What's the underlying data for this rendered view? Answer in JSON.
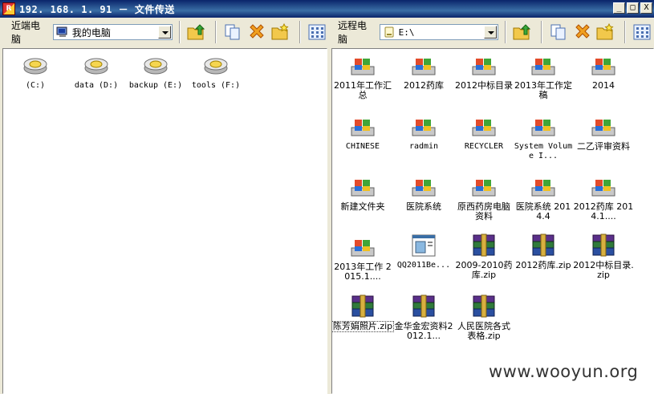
{
  "window": {
    "title": "192. 168. 1. 91 － 文件传送",
    "min_glyph": "_",
    "max_glyph": "□",
    "close_glyph": "X"
  },
  "left": {
    "label": "近端电脑",
    "location": "我的电脑",
    "location_icon": "my-computer-icon",
    "items": [
      {
        "label": "(C:)",
        "icon": "drive-icon"
      },
      {
        "label": "data (D:)",
        "icon": "drive-icon"
      },
      {
        "label": "backup (E:)",
        "icon": "drive-icon"
      },
      {
        "label": "tools (F:)",
        "icon": "drive-icon"
      }
    ]
  },
  "right": {
    "label": "远程电脑",
    "location": "E:\\",
    "location_icon": "drive-icon",
    "items": [
      {
        "label": "2011年工作汇总",
        "icon": "folder-icon"
      },
      {
        "label": "2012药库",
        "icon": "folder-icon"
      },
      {
        "label": "2012中标目录",
        "icon": "folder-icon"
      },
      {
        "label": "2013年工作定稿",
        "icon": "folder-icon"
      },
      {
        "label": "2014",
        "icon": "folder-icon"
      },
      {
        "label": "CHINESE",
        "icon": "folder-icon"
      },
      {
        "label": "radmin",
        "icon": "folder-icon"
      },
      {
        "label": "RECYCLER",
        "icon": "folder-icon"
      },
      {
        "label": "System Volume I...",
        "icon": "folder-icon"
      },
      {
        "label": "二乙评审资料",
        "icon": "folder-icon"
      },
      {
        "label": "新建文件夹",
        "icon": "folder-icon"
      },
      {
        "label": "医院系统",
        "icon": "folder-icon"
      },
      {
        "label": "原西药房电脑资料",
        "icon": "folder-icon"
      },
      {
        "label": "医院系统 2014.4",
        "icon": "folder-icon"
      },
      {
        "label": "2012药库 2014.1....",
        "icon": "folder-icon"
      },
      {
        "label": "2013年工作 2015.1....",
        "icon": "folder-icon"
      },
      {
        "label": "QQ2011Be...",
        "icon": "installer-icon"
      },
      {
        "label": "2009-2010药库.zip",
        "icon": "archive-icon"
      },
      {
        "label": "2012药库.zip",
        "icon": "archive-icon"
      },
      {
        "label": "2012中标目录.zip",
        "icon": "archive-icon"
      },
      {
        "label": "陈芳娟照片.zip",
        "icon": "archive-icon",
        "selected": true
      },
      {
        "label": "金华金宏资料2012.1...",
        "icon": "archive-icon"
      },
      {
        "label": "人民医院各式表格.zip",
        "icon": "archive-icon"
      }
    ]
  },
  "watermark": "www.wooyun.org"
}
